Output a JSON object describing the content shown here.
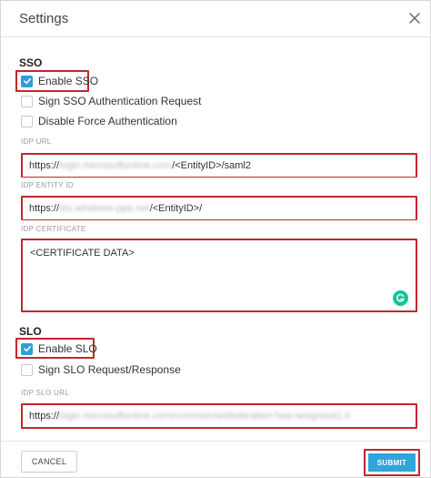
{
  "dialog": {
    "title": "Settings"
  },
  "sso": {
    "heading": "SSO",
    "enable_label": "Enable SSO",
    "enable_checked": true,
    "sign_request_label": "Sign SSO Authentication Request",
    "sign_request_checked": false,
    "disable_force_label": "Disable Force Authentication",
    "disable_force_checked": false,
    "idp_url": {
      "label": "IDP URL",
      "prefix": "https://",
      "redacted": "login.microsoftonline.com",
      "suffix": "/<EntityID>/saml2"
    },
    "idp_entity_id": {
      "label": "IDP ENTITY ID",
      "prefix": "https://",
      "redacted": "sts.windows-ppe.net",
      "suffix": "/<EntityID>/"
    },
    "idp_certificate": {
      "label": "IDP CERTIFICATE",
      "value": "<CERTIFICATE DATA>"
    }
  },
  "slo": {
    "heading": "SLO",
    "enable_label": "Enable SLO",
    "enable_checked": true,
    "sign_label": "Sign SLO Request/Response",
    "sign_checked": false,
    "idp_slo_url": {
      "label": "IDP SLO URL",
      "prefix": "https://",
      "redacted": "login.microsoftonline.com/common/wsfederation?wa=wsignout1.0"
    }
  },
  "footer": {
    "cancel_label": "CANCEL",
    "submit_label": "SUBMIT"
  },
  "colors": {
    "accent": "#2f9fd9",
    "highlight": "#c1272d",
    "grammarly": "#15c39a"
  },
  "icons": {
    "close": "close-icon",
    "check": "checkmark-icon",
    "grammarly": "grammarly-icon"
  }
}
